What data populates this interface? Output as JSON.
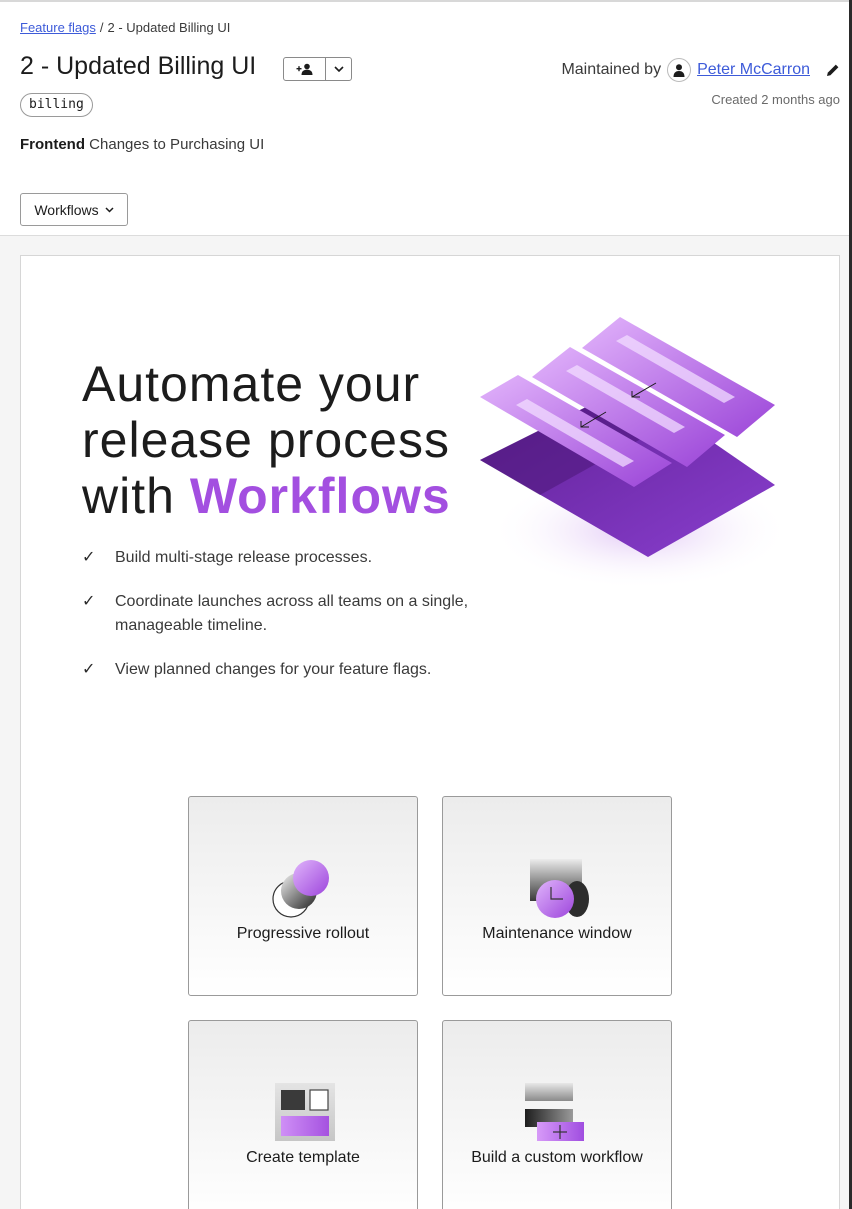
{
  "breadcrumb": {
    "parent": "Feature flags",
    "separator": "/",
    "current": "2 - Updated Billing UI"
  },
  "flag": {
    "title": "2 - Updated Billing UI",
    "tag": "billing",
    "description_bold": "Frontend",
    "description": "Changes to Purchasing UI"
  },
  "maintainer": {
    "label": "Maintained by",
    "name": "Peter McCarron",
    "created": "Created 2 months ago"
  },
  "workflows_menu": {
    "label": "Workflows"
  },
  "hero": {
    "title_line1": "Automate your",
    "title_line2": "release process",
    "title_line3_prefix": "with ",
    "title_accent": "Workflows",
    "check_glyph": "✓",
    "features": [
      "Build multi-stage release processes.",
      "Coordinate launches across all teams on a single, manageable timeline.",
      "View planned changes for your feature flags."
    ]
  },
  "options": [
    {
      "label": "Progressive rollout",
      "icon": "progressive-rollout-icon"
    },
    {
      "label": "Maintenance window",
      "icon": "maintenance-window-icon"
    },
    {
      "label": "Create template",
      "icon": "template-icon"
    },
    {
      "label": "Build a custom workflow",
      "icon": "custom-workflow-icon"
    }
  ],
  "colors": {
    "accent": "#a34fe0",
    "link": "#3d5bd9",
    "purple_dark": "#6a2a9e"
  }
}
